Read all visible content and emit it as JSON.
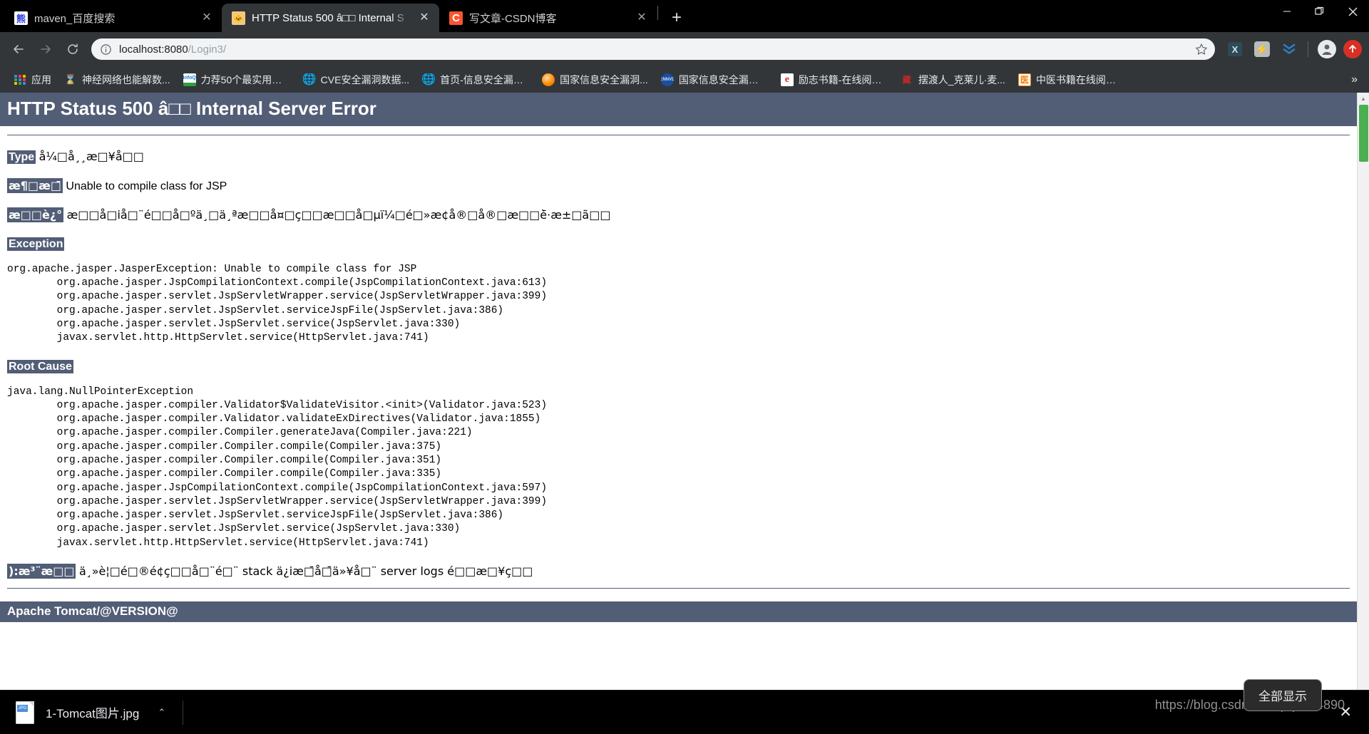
{
  "browser": {
    "tabs": [
      {
        "title": "maven_百度搜索",
        "favicon": "baidu-favicon",
        "active": false,
        "close_label": "✕"
      },
      {
        "title": "HTTP Status 500 â□□ Internal S",
        "favicon": "tomcat-favicon",
        "active": true,
        "close_label": "✕"
      },
      {
        "title": "写文章-CSDN博客",
        "favicon": "csdn-favicon",
        "active": false,
        "close_label": "✕"
      }
    ],
    "new_tab_label": "+",
    "window_controls": {
      "minimize": "—",
      "maximize": "❐",
      "close": "✕"
    },
    "nav": {
      "back": "←",
      "forward": "→",
      "reload": "⟳"
    },
    "omnibox": {
      "url_host": "localhost:8080",
      "url_path": "/Login3/",
      "full_url": "localhost:8080/Login3/",
      "info_icon": "info-circle-icon",
      "star_icon": "bookmark-star-icon"
    },
    "extensions": [
      {
        "name": "x-extension-icon",
        "label": "X"
      },
      {
        "name": "lightning-extension-icon",
        "label": "⚡"
      },
      {
        "name": "double-chevron-down-extension-icon",
        "label": "»"
      }
    ],
    "profile_icon": "profile-avatar-icon",
    "update_icon": "upload-arrow-icon",
    "bookmarks": [
      {
        "label": "应用",
        "icon": "apps-grid-icon"
      },
      {
        "label": "神经网络也能解数...",
        "icon": "hourglass-icon"
      },
      {
        "label": "力荐50个最实用的...",
        "icon": "infoq-icon"
      },
      {
        "label": "CVE安全漏洞数据...",
        "icon": "globe-icon"
      },
      {
        "label": "首页-信息安全漏洞...",
        "icon": "globe-icon"
      },
      {
        "label": "国家信息安全漏洞...",
        "icon": "orange-orb-icon"
      },
      {
        "label": "国家信息安全漏洞库",
        "icon": "cnnvd-icon"
      },
      {
        "label": "励志书籍-在线阅读...",
        "icon": "red-e-icon"
      },
      {
        "label": "摆渡人_克莱儿·麦...",
        "icon": "zang-icon"
      },
      {
        "label": "中医书籍在线阅读,...",
        "icon": "yi-icon"
      }
    ],
    "bookmarks_overflow": "»"
  },
  "page": {
    "title": "HTTP Status 500 â□□ Internal Server Error",
    "type": {
      "label": "Type",
      "value": "å¼□å¸¸æ□¥å□□"
    },
    "message": {
      "label": "æ¶□æ□̄",
      "value": "Unable to compile class for JSP"
    },
    "description": {
      "label": "æ□□è¿°",
      "value": "æ□□å□iå□¨é□□å□ºä¸□ä¸ªæ□□å¤□ç□□æ□□å□µï¼□é□»æ¢å®□å®□æ□□è̄·æ±□ã□□"
    },
    "exception": {
      "label": "Exception",
      "stack": "org.apache.jasper.JasperException: Unable to compile class for JSP\n\torg.apache.jasper.JspCompilationContext.compile(JspCompilationContext.java:613)\n\torg.apache.jasper.servlet.JspServletWrapper.service(JspServletWrapper.java:399)\n\torg.apache.jasper.servlet.JspServlet.serviceJspFile(JspServlet.java:386)\n\torg.apache.jasper.servlet.JspServlet.service(JspServlet.java:330)\n\tjavax.servlet.http.HttpServlet.service(HttpServlet.java:741)"
    },
    "root_cause": {
      "label": "Root Cause",
      "stack": "java.lang.NullPointerException\n\torg.apache.jasper.compiler.Validator$ValidateVisitor.<init>(Validator.java:523)\n\torg.apache.jasper.compiler.Validator.validateExDirectives(Validator.java:1855)\n\torg.apache.jasper.compiler.Compiler.generateJava(Compiler.java:221)\n\torg.apache.jasper.compiler.Compiler.compile(Compiler.java:375)\n\torg.apache.jasper.compiler.Compiler.compile(Compiler.java:351)\n\torg.apache.jasper.compiler.Compiler.compile(Compiler.java:335)\n\torg.apache.jasper.JspCompilationContext.compile(JspCompilationContext.java:597)\n\torg.apache.jasper.servlet.JspServletWrapper.service(JspServletWrapper.java:399)\n\torg.apache.jasper.servlet.JspServlet.serviceJspFile(JspServlet.java:386)\n\torg.apache.jasper.servlet.JspServlet.service(JspServlet.java:330)\n\tjavax.servlet.http.HttpServlet.service(HttpServlet.java:741)"
    },
    "note": {
      "label": "):æ³¨æ□□",
      "value": "ä¸»è¦□é□®é¢ç□□å□¨é□¨ stack ä¿iæ□̄å□̄ä»¥å□¨ server logs é□□æ□¥ç□□"
    },
    "footer": "Apache Tomcat/@VERSION@",
    "scrollbar": {
      "up_arrow": "▲",
      "down_arrow": "▼",
      "thumb_color": "#4caf50"
    }
  },
  "download_shelf": {
    "item": {
      "filename": "1-Tomcat图片.jpg",
      "icon": "jpg-file-icon",
      "menu_chevron": "⌃",
      "badge": "JPG"
    },
    "show_all_label": "全部显示",
    "close_label": "✕"
  },
  "watermark": "https://blog.csdn.net/opq1314890",
  "colors": {
    "tomcat_bar": "#525d76",
    "chrome_toolbar": "#323639",
    "chrome_tabstrip": "#000000",
    "accent_red": "#d93025",
    "scrollbar_thumb": "#4caf50"
  }
}
